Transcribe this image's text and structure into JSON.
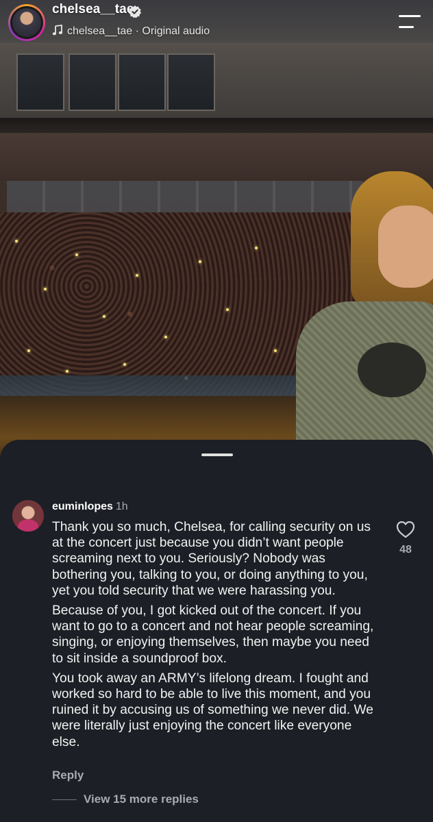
{
  "reel": {
    "username": "chelsea__tae",
    "verified_icon": "verified-badge-icon",
    "audio_icon": "music-note-icon",
    "audio_text": "chelsea__tae · Original audio",
    "menu_icon": "menu-icon"
  },
  "comments": {
    "username": "euminlopes",
    "time": "1h",
    "paragraphs": [
      "Thank you so much, Chelsea, for calling security on us at the concert just because you didn’t want people screaming next to you. Seriously? Nobody was bothering you, talking to you, or doing anything to you, yet you told security that we were harassing you.",
      "Because of you, I got kicked out of the concert. If you want to go to a concert and not hear people screaming, singing, or enjoying themselves, then maybe you need to sit inside a soundproof box.",
      "You took away an ARMY’s lifelong dream. I fought and worked so hard to be able to live this moment, and you ruined it by accusing us of something we never did. We were literally just enjoying the concert like everyone else."
    ],
    "like_icon": "heart-outline-icon",
    "like_count": "48",
    "reply_label": "Reply",
    "view_more_label": "View 15 more replies"
  },
  "colors": {
    "sheet_bg": "#1c1f25",
    "muted_text": "#a8abb3",
    "verified_blue": "#3897f0"
  }
}
